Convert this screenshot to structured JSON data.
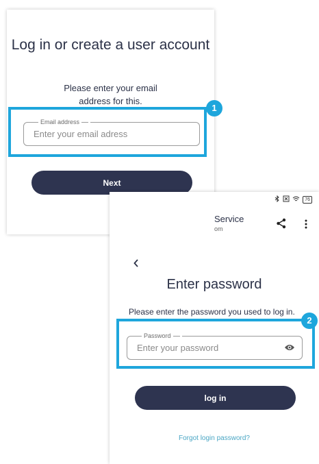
{
  "screen_email": {
    "title": "Log in or create a user account",
    "subtitle": "Please enter your email address for this.",
    "email_field": {
      "label": "Email address",
      "placeholder": "Enter your email adress"
    },
    "next_button": "Next",
    "badge": "1"
  },
  "screen_password": {
    "status_icons": [
      "bluetooth-icon",
      "nfc-icon",
      "wifi-icon",
      "battery-icon"
    ],
    "battery_level": "76",
    "app_title": "Service",
    "app_subtitle": "om",
    "title": "Enter password",
    "subtitle": "Please enter the password you used to log in.",
    "password_field": {
      "label": "Password",
      "placeholder": "Enter your password"
    },
    "login_button": "log in",
    "forgot_link": "Forgot login password?",
    "badge": "2"
  },
  "colors": {
    "highlight": "#1ea6dc",
    "button": "#2e3450",
    "text": "#2b3147",
    "link": "#4aa6c4"
  }
}
